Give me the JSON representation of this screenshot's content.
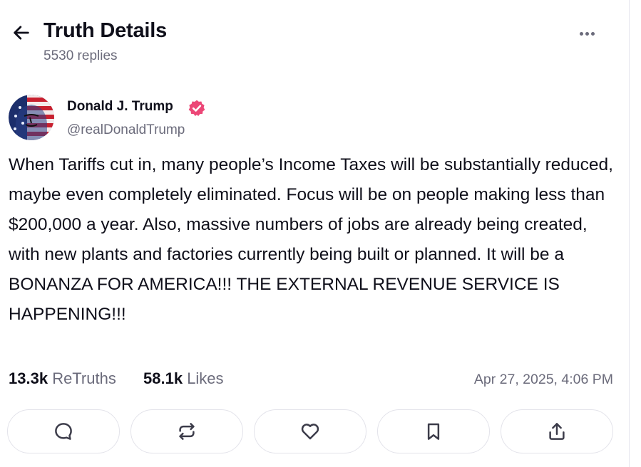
{
  "header": {
    "title": "Truth Details",
    "replies": "5530 replies"
  },
  "icons": {
    "back": "arrow-left-icon",
    "more": "more-horizontal-icon",
    "verified": "verified-badge-icon",
    "reply": "reply-icon",
    "retruth": "retruth-icon",
    "like": "heart-icon",
    "bookmark": "bookmark-icon",
    "share": "share-icon"
  },
  "post": {
    "author": {
      "name": "Donald J. Trump",
      "handle": "@realDonaldTrump"
    },
    "text": "When Tariffs cut in, many people’s Income Taxes will be substantially reduced, maybe even completely eliminated. Focus will be on people making less than $200,000 a year. Also, massive numbers of jobs are already being created, with new plants and factories currently being built or planned. It will be a BONANZA FOR AMERICA!!! THE EXTERNAL REVENUE SERVICE IS HAPPENING!!!",
    "stats": {
      "retruths_count": "13.3k",
      "retruths_label": "ReTruths",
      "likes_count": "58.1k",
      "likes_label": "Likes"
    },
    "timestamp": "Apr 27, 2025, 4:06 PM"
  },
  "colors": {
    "text": "#0f0f1a",
    "muted": "#6b6b7b",
    "verified": "#ec4777",
    "border": "#e3e3ea"
  }
}
